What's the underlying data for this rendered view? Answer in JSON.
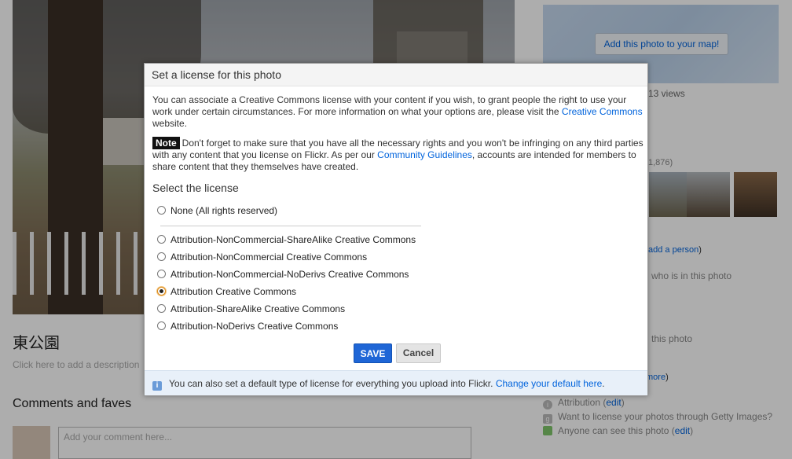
{
  "background": {
    "map_button_label": "Add this photo to your map!",
    "views_text": "13 views",
    "count_text": "1,876)",
    "add_person_link": "add a person",
    "add_person_close": ")",
    "who_in_photo_text": "who is in this photo",
    "this_photo_text": "this photo",
    "more_link": "more",
    "more_close": ")",
    "photo_title": "東公園",
    "description_placeholder": "Click here to add a description",
    "comments_heading": "Comments and faves",
    "comment_placeholder": "Add your comment here...",
    "license_rows": [
      {
        "label": "Attribution",
        "link": "edit",
        "icon": "info-circle-icon"
      },
      {
        "label": "Want to license your photos through Getty Images?",
        "link": "",
        "icon": "getty-icon"
      },
      {
        "label": "Anyone can see this photo",
        "link": "edit",
        "icon": "privacy-icon"
      }
    ]
  },
  "dialog": {
    "title": "Set a license for this photo",
    "intro_text": "You can associate a Creative Commons license with your content if you wish, to grant people the right to use your work under certain circumstances. For more information on what your options are, please visit the ",
    "intro_link": "Creative Commons",
    "intro_suffix": " website.",
    "note_badge": "Note",
    "note_text": "Don't forget to make sure that you have all the necessary rights and you won't be infringing on any third parties with any content that you license on Flickr. As per our ",
    "note_link": "Community Guidelines",
    "note_suffix": ", accounts are intended for members to share content that they themselves have created.",
    "select_heading": "Select the license",
    "options": [
      {
        "label": "None (All rights reserved)",
        "checked": false
      },
      {
        "label": "Attribution-NonCommercial-ShareAlike Creative Commons",
        "checked": false
      },
      {
        "label": "Attribution-NonCommercial Creative Commons",
        "checked": false
      },
      {
        "label": "Attribution-NonCommercial-NoDerivs Creative Commons",
        "checked": false
      },
      {
        "label": "Attribution Creative Commons",
        "checked": true
      },
      {
        "label": "Attribution-ShareAlike Creative Commons",
        "checked": false
      },
      {
        "label": "Attribution-NoDerivs Creative Commons",
        "checked": false
      }
    ],
    "save_label": "SAVE",
    "cancel_label": "Cancel",
    "footer_text": "You can also set a default type of license for everything you upload into Flickr. ",
    "footer_link": "Change your default here",
    "footer_suffix": ".",
    "info_icon_glyph": "i"
  },
  "colors": {
    "link": "#0063dc",
    "save_button": "#1f66d6",
    "footer_bg": "#e8f0f9",
    "overlay": "rgba(0,0,0,0.32)"
  }
}
